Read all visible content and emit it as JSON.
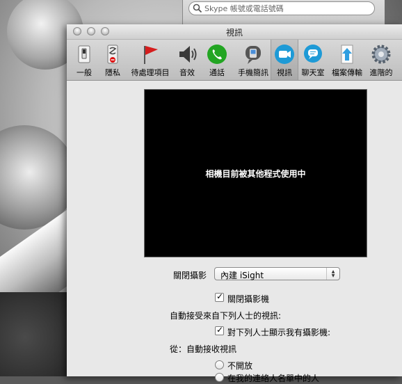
{
  "skype": {
    "search_placeholder": "Skype 帳號或電話號碼"
  },
  "window": {
    "title": "視訊"
  },
  "toolbar": {
    "items": [
      {
        "label": "一般",
        "icon": "switch-icon"
      },
      {
        "label": "隱私",
        "icon": "privacy-icon"
      },
      {
        "label": "待處理項目",
        "icon": "flag-icon"
      },
      {
        "label": "音效",
        "icon": "speaker-icon"
      },
      {
        "label": "通話",
        "icon": "phone-icon"
      },
      {
        "label": "手機簡訊",
        "icon": "sms-icon"
      },
      {
        "label": "視訊",
        "icon": "video-camera-icon",
        "selected": true
      },
      {
        "label": "聊天室",
        "icon": "chat-bubble-icon"
      },
      {
        "label": "檔案傳輸",
        "icon": "upload-arrow-icon"
      },
      {
        "label": "進階的",
        "icon": "gear-icon"
      }
    ]
  },
  "video": {
    "preview_message": "相機目前被其他程式使用中",
    "camera_label": "關閉攝影",
    "camera_selected": "內建 iSight",
    "disable_camera_label": "關閉攝影機",
    "disable_camera_checked": true,
    "auto_receive_heading": "自動接受來自下列人士的視訊:",
    "show_camera_label": "對下列人士顯示我有攝影機:",
    "show_camera_checked": true,
    "from_heading": "從：自動接收視訊",
    "option_none": "不開放",
    "option_contacts": "在我的連絡人名單中的人"
  },
  "colors": {
    "preview_bg": "#000000",
    "window_bg": "#e8e8e8",
    "selected_tab": "#b4b4b4"
  }
}
